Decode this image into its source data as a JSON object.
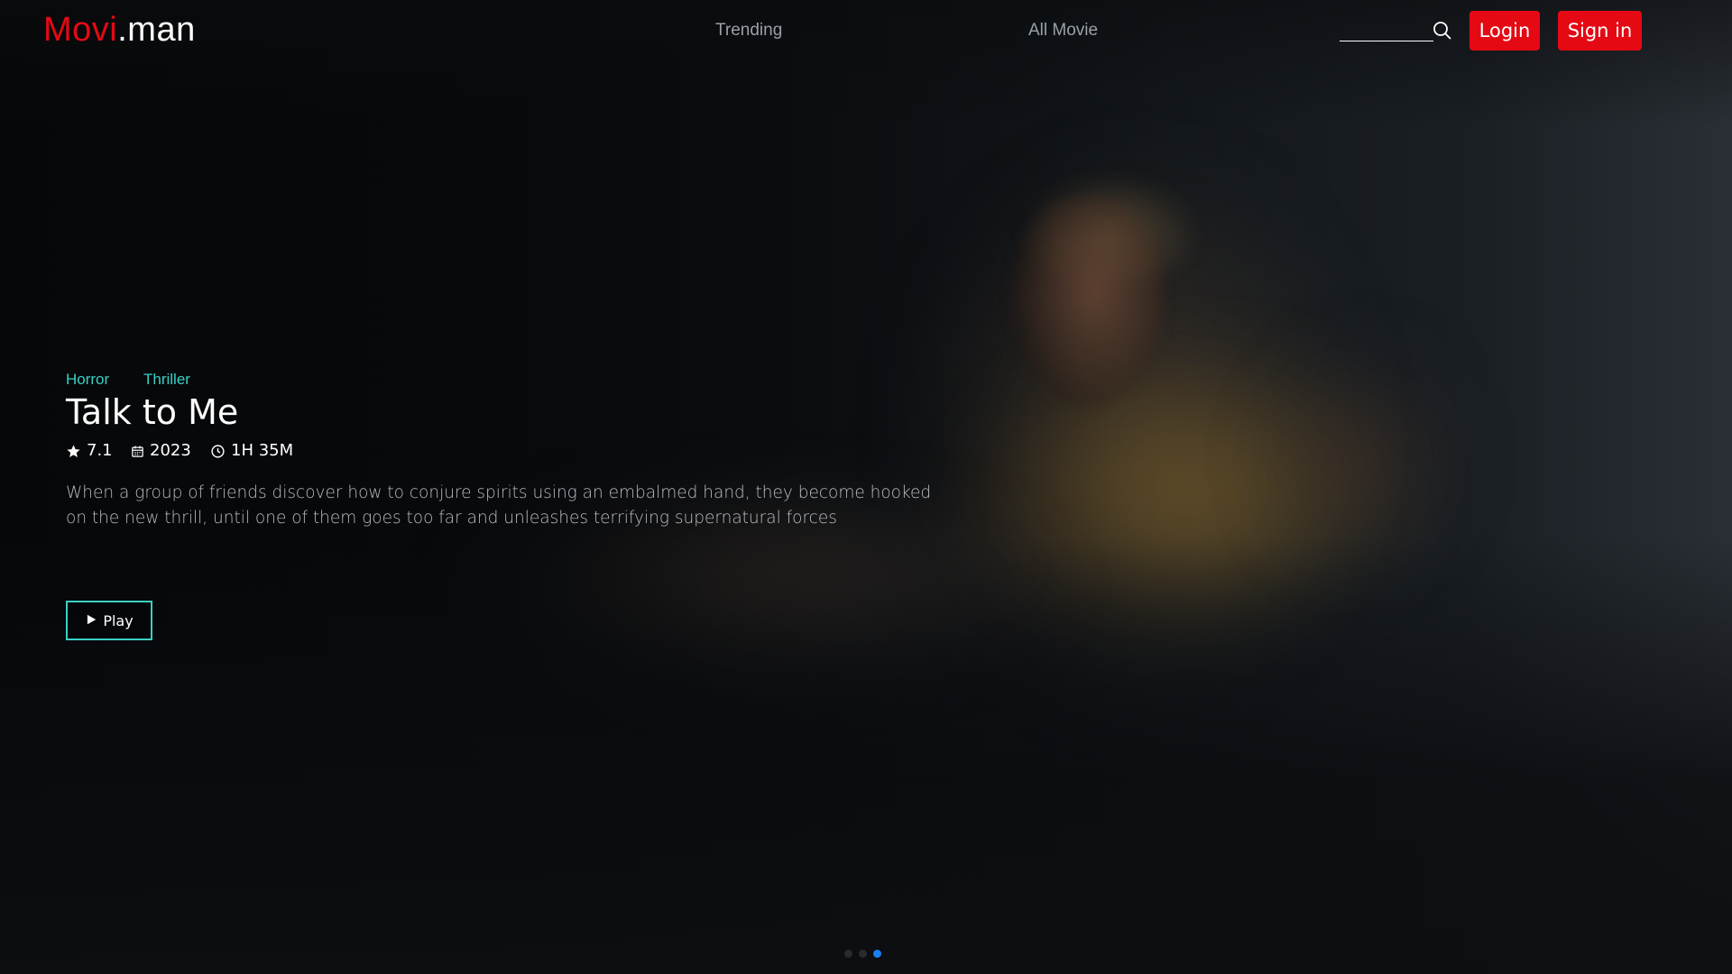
{
  "brand": {
    "logo_red": "Movi",
    "logo_white": ".man"
  },
  "nav": {
    "trending": "Trending",
    "all_movie": "All Movie"
  },
  "search": {
    "value": "",
    "placeholder": ""
  },
  "auth": {
    "login": "Login",
    "signin": "Sign in"
  },
  "movie": {
    "genres": [
      "Horror",
      "Thriller"
    ],
    "title": "Talk to Me",
    "rating": "7.1",
    "year": "2023",
    "duration": "1H 35M",
    "description": "When a group of friends discover how to conjure spirits using an embalmed hand, they become hooked on the new thrill, until one of them goes too far and unleashes terrifying supernatural forces",
    "play_label": "Play"
  },
  "carousel": {
    "slides": 3,
    "active_index": 2
  },
  "colors": {
    "accent_red": "#e50914",
    "accent_teal": "#39d0c4",
    "dot_active": "#1a7ff0"
  },
  "icons": {
    "search": "search-icon",
    "rating": "star-icon",
    "year": "calendar-icon",
    "duration": "clock-icon",
    "play": "play-icon"
  }
}
